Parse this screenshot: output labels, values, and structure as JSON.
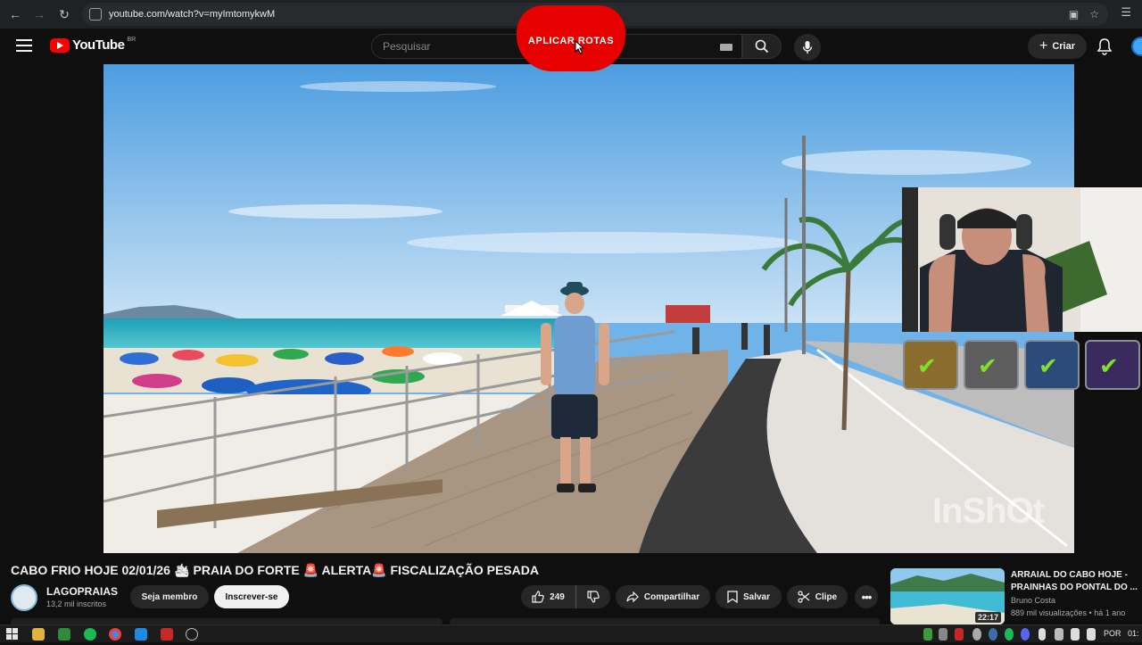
{
  "browser": {
    "url": "youtube.com/watch?v=myImtomykwM"
  },
  "header": {
    "logo_text": "YouTube",
    "country": "BR",
    "search_placeholder": "Pesquisar",
    "create_label": "Criar"
  },
  "overlay": {
    "text": "APLICAR ROTAS"
  },
  "video": {
    "watermark": "InShOt"
  },
  "info": {
    "title": "CABO FRIO HOJE 02/01/26 🛳 PRAIA DO FORTE 🚨 ALERTA🚨 FISCALIZAÇÃO PESADA",
    "channel_name": "LAGOPRAIAS",
    "subscribers": "13,2 mil inscritos",
    "member_label": "Seja membro",
    "subscribe_label": "Inscrever-se",
    "like_count": "249",
    "share_label": "Compartilhar",
    "save_label": "Salvar",
    "clip_label": "Clipe",
    "more_label": "•••"
  },
  "up_next": {
    "title": "ARRAIAL DO CABO HOJE - PRAINHAS DO PONTAL DO ...",
    "channel": "Bruno Costa",
    "meta": "889 mil visualizações • há 1 ano",
    "duration": "22:17"
  },
  "taskbar": {
    "language": "POR",
    "clock": "01:"
  },
  "colors": {
    "brand_red": "#ff0000",
    "overlay_red": "#e60000",
    "background": "#0f0f0f",
    "check_green": "#7fe02a"
  }
}
